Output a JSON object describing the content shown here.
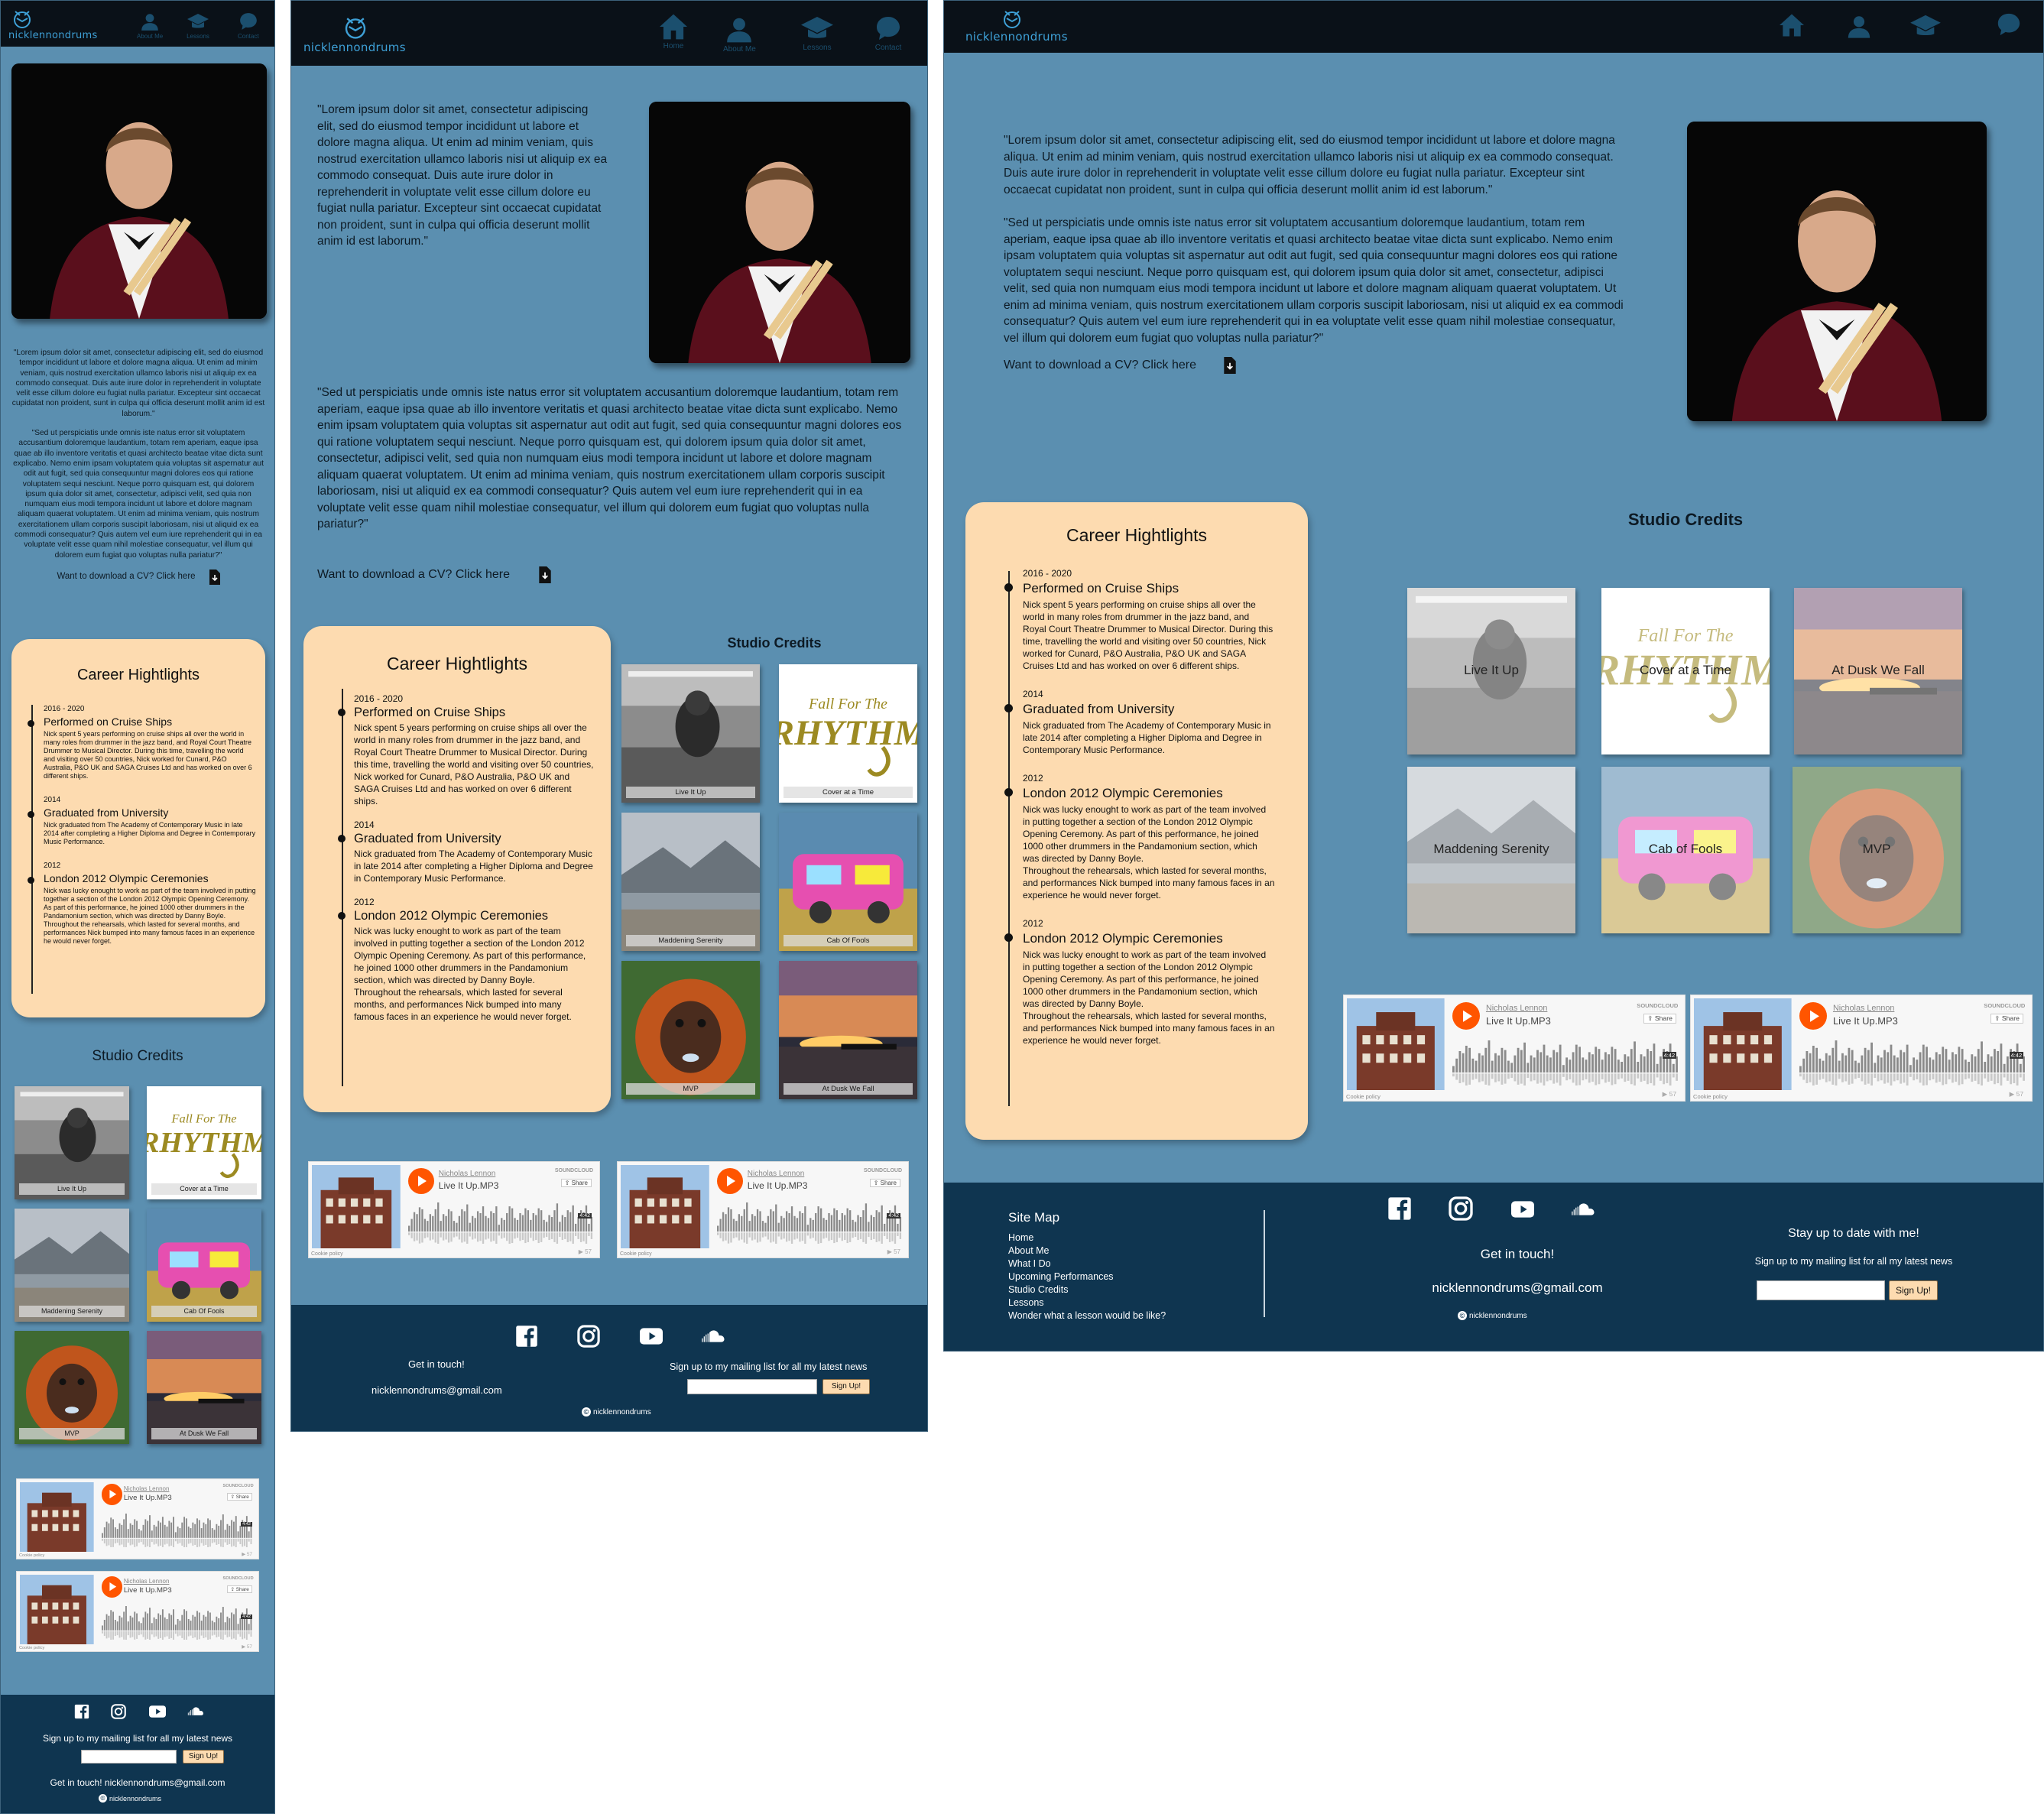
{
  "brand": "nicklennondrums",
  "nav": {
    "home": "Home",
    "about": "About Me",
    "lessons": "Lessons",
    "contact": "Contact"
  },
  "quote1": "\"Lorem ipsum dolor sit amet, consectetur adipiscing elit, sed do eiusmod tempor incididunt ut labore et dolore magna aliqua. Ut enim ad minim veniam, quis nostrud exercitation ullamco laboris nisi ut aliquip ex ea commodo consequat. Duis aute irure dolor in reprehenderit in voluptate velit esse cillum dolore eu fugiat nulla pariatur. Excepteur sint occaecat cupidatat non proident, sunt in culpa qui officia deserunt mollit anim id est laborum.\"",
  "quote2": "\"Sed ut perspiciatis unde omnis iste natus error sit voluptatem accusantium doloremque laudantium, totam rem aperiam, eaque ipsa quae ab illo inventore veritatis et quasi architecto beatae vitae dicta sunt explicabo. Nemo enim ipsam voluptatem quia voluptas sit aspernatur aut odit aut fugit, sed quia consequuntur magni dolores eos qui ratione voluptatem sequi nesciunt. Neque porro quisquam est, qui dolorem ipsum quia dolor sit amet, consectetur, adipisci velit, sed quia non numquam eius modi tempora incidunt ut labore et dolore magnam aliquam quaerat voluptatem. Ut enim ad minima veniam, quis nostrum exercitationem ullam corporis suscipit laboriosam, nisi ut aliquid ex ea commodi consequatur? Quis autem vel eum iure reprehenderit qui in ea voluptate velit esse quam nihil molestiae consequatur, vel illum qui dolorem eum fugiat quo voluptas nulla pariatur?\"",
  "cv_text": "Want to download a CV? Click here",
  "career": {
    "heading": "Career Hightlights",
    "items": [
      {
        "year": "2016 - 2020",
        "title": "Performed on Cruise Ships",
        "text": "Nick spent 5 years performing on  cruise ships all over the world in many roles from drummer in the jazz band, and Royal Court Theatre Drummer to Musical Director. During this time, travelling the world and visiting over 50 countries, Nick worked for Cunard, P&O Australia, P&O UK and SAGA Cruises Ltd and has worked on over 6 different ships."
      },
      {
        "year": "2014",
        "title": "Graduated from University",
        "text": "Nick graduated from The Academy of Contemporary Music in late 2014 after completing a Higher Diploma and Degree in Contemporary Music Performance."
      },
      {
        "year": "2012",
        "title": "London 2012 Olympic Ceremonies",
        "text": "Nick was lucky enought to work as part of the team involved in putting together a section of the London 2012 Olympic Opening Ceremony. As part of this performance, he joined 1000 other drummers in the Pandamonium section, which was directed by Danny Boyle.\nThroughout the rehearsals, which lasted for several months, and performances Nick bumped into many famous faces in an experience he would never forget."
      }
    ]
  },
  "credits": {
    "heading": "Studio Credits",
    "items": [
      "Live It Up",
      "Cover at a Time",
      "Maddening Serenity",
      "Cab Of Fools",
      "MVP",
      "At Dusk We Fall"
    ],
    "desktop_items": [
      "Live It Up",
      "Cover at a Time",
      "At Dusk We Fall",
      "Maddening Serenity",
      "Cab of Fools",
      "MVP"
    ]
  },
  "soundcloud": {
    "artist": "Nicholas Lennon",
    "track": "Live It Up.MP3",
    "logo": "SOUNDCLOUD",
    "share": "Share",
    "duration": "4:42",
    "plays": "57",
    "cookie": "Cookie policy"
  },
  "footer": {
    "sitemap_title": "Site Map",
    "sitemap": [
      "Home",
      "About Me",
      "What I Do",
      "Upcoming Performances",
      "Studio Credits",
      "Lessons",
      "Wonder what a lesson would be like?"
    ],
    "get_in_touch": "Get in touch!",
    "email": "nicklennondrums@gmail.com",
    "mobile_contact": "Get in touch! nicklennondrums@gmail.com",
    "stay": "Stay up to date with me!",
    "signup_text": "Sign up to my mailing list for all my latest news",
    "signup_btn": "Sign Up!",
    "copyright": "nicklennondrums"
  },
  "icons": [
    "logo-icon",
    "home-icon",
    "user-icon",
    "graduation-cap-icon",
    "chat-icon",
    "download-icon",
    "facebook-icon",
    "instagram-icon",
    "youtube-icon",
    "soundcloud-icon",
    "play-icon",
    "share-icon"
  ]
}
